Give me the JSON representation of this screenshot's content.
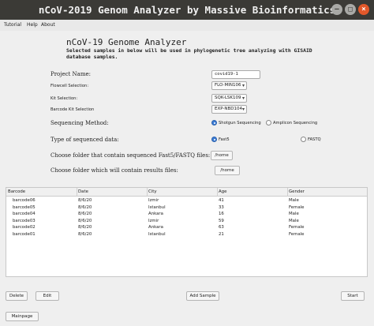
{
  "window": {
    "title": "nCoV-2019 Genom Analyzer by Massive Bioinformatics",
    "controls": {
      "minimize": "–",
      "maximize": "□",
      "close": "×"
    }
  },
  "menu": [
    "Tutorial",
    "Help",
    "About"
  ],
  "header": {
    "heading": "nCoV-19 Genome Analyzer",
    "description": "Selected samples in below will be used in phylogenetic tree analyzing with GISAID database samples."
  },
  "form": {
    "project_name_label": "Project Name:",
    "project_name_value": "covid19-1",
    "flowcell_label": "Flowcell Selection:",
    "flowcell_value": "FLO-MIN106",
    "kit_label": "Kit Selection:",
    "kit_value": "SQK-LSK109",
    "barcode_kit_label": "Barcode Kit Selection",
    "barcode_kit_value": "EXP-NBD104",
    "seq_method_label": "Sequencing Method:",
    "seq_method_option_1": "Shotgun Sequencing",
    "seq_method_option_2": "Amplicon Sequencing",
    "seq_method_selected": "Shotgun Sequencing",
    "data_type_label": "Type of sequenced data:",
    "data_type_option_1": "Fast5",
    "data_type_option_2": "FASTQ",
    "data_type_selected": "Fast5",
    "input_folder_label": "Choose folder that contain sequenced Fast5/FASTQ files:",
    "input_folder_value": "/home",
    "output_folder_label": "Choose folder which will contain results files:",
    "output_folder_value": "/home"
  },
  "table": {
    "columns": [
      "Barcode",
      "Date",
      "City",
      "Age",
      "Gender"
    ],
    "rows": [
      [
        "barcode06",
        "8/6/20",
        "Izmir",
        "41",
        "Male"
      ],
      [
        "barcode05",
        "8/6/20",
        "Istanbul",
        "33",
        "Female"
      ],
      [
        "barcode04",
        "8/6/20",
        "Ankara",
        "16",
        "Male"
      ],
      [
        "barcode03",
        "8/6/20",
        "Izmir",
        "59",
        "Male"
      ],
      [
        "barcode02",
        "8/6/20",
        "Ankara",
        "63",
        "Female"
      ],
      [
        "barcode01",
        "8/6/20",
        "Istanbul",
        "21",
        "Female"
      ]
    ]
  },
  "buttons": {
    "delete": "Delete",
    "edit": "Edit",
    "add_sample": "Add Sample",
    "start": "Start",
    "mainpage": "Mainpage"
  }
}
